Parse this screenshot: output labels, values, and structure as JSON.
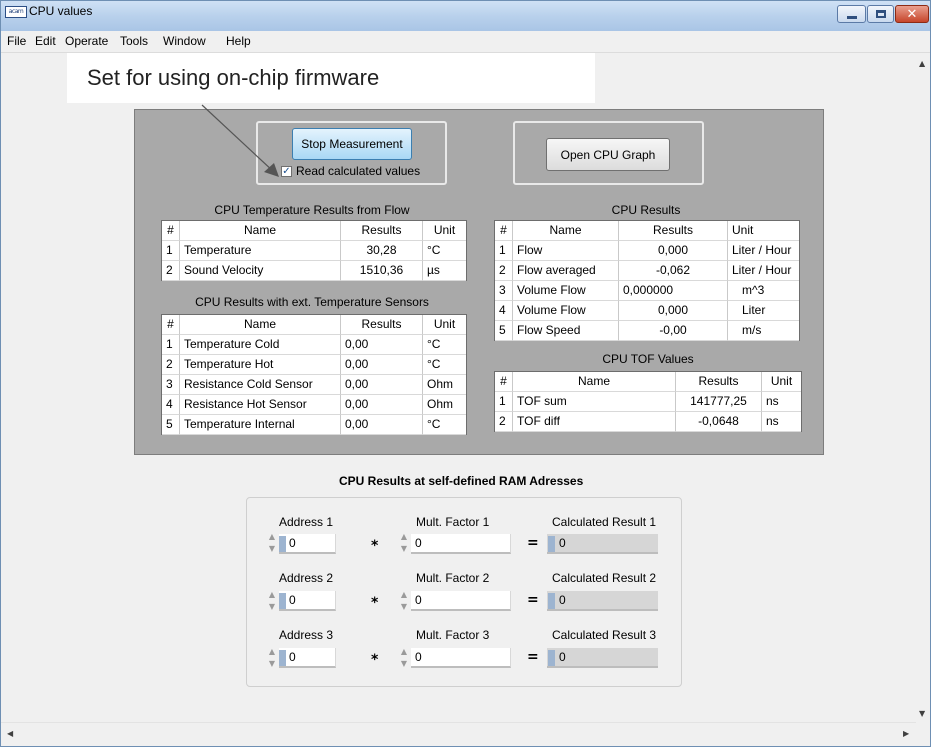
{
  "window": {
    "title": "CPU values",
    "app_icon_text": "acam"
  },
  "menu": [
    "File",
    "Edit",
    "Operate",
    "Tools",
    "Window",
    "Help"
  ],
  "callout": "Set for using on-chip firmware",
  "controls": {
    "stop_button": "Stop Measurement",
    "read_calculated_label": "Read calculated values",
    "read_calculated_checked": true,
    "open_graph_button": "Open CPU Graph"
  },
  "temperature_flow": {
    "title": "CPU Temperature Results from Flow",
    "headers": [
      "#",
      "Name",
      "Results",
      "Unit"
    ],
    "rows": [
      [
        "1",
        "Temperature",
        "30,28",
        "°C"
      ],
      [
        "2",
        "Sound Velocity",
        "1510,36",
        "µs"
      ]
    ]
  },
  "ext_sensors": {
    "title": "CPU Results with ext. Temperature Sensors",
    "headers": [
      "#",
      "Name",
      "Results",
      "Unit"
    ],
    "rows": [
      [
        "1",
        "Temperature Cold",
        "0,00",
        "°C"
      ],
      [
        "2",
        "Temperature Hot",
        "0,00",
        "°C"
      ],
      [
        "3",
        "Resistance Cold Sensor",
        "0,00",
        "Ohm"
      ],
      [
        "4",
        "Resistance Hot Sensor",
        "0,00",
        "Ohm"
      ],
      [
        "5",
        "Temperature Internal",
        "0,00",
        "°C"
      ]
    ]
  },
  "cpu_results": {
    "title": "CPU Results",
    "headers": [
      "#",
      "Name",
      "Results",
      "Unit"
    ],
    "rows": [
      [
        "1",
        "Flow",
        "0,000",
        "Liter / Hour"
      ],
      [
        "2",
        "Flow averaged",
        "-0,062",
        "Liter / Hour"
      ],
      [
        "3",
        "Volume Flow",
        "0,000000",
        "m^3"
      ],
      [
        "4",
        "Volume Flow",
        "0,000",
        "Liter"
      ],
      [
        "5",
        "Flow Speed",
        "-0,00",
        "m/s"
      ]
    ]
  },
  "tof_values": {
    "title": "CPU TOF Values",
    "headers": [
      "#",
      "Name",
      "Results",
      "Unit"
    ],
    "rows": [
      [
        "1",
        "TOF sum",
        "141777,25",
        "ns"
      ],
      [
        "2",
        "TOF diff",
        "-0,0648",
        "ns"
      ]
    ]
  },
  "ram": {
    "title": "CPU Results at self-defined RAM Adresses",
    "rows": [
      {
        "address_label": "Address 1",
        "address_value": "0",
        "factor_label": "Mult. Factor 1",
        "factor_value": "0",
        "result_label": "Calculated Result 1",
        "result_value": "0"
      },
      {
        "address_label": "Address 2",
        "address_value": "0",
        "factor_label": "Mult. Factor 2",
        "factor_value": "0",
        "result_label": "Calculated Result 2",
        "result_value": "0"
      },
      {
        "address_label": "Address 3",
        "address_value": "0",
        "factor_label": "Mult. Factor 3",
        "factor_value": "0",
        "result_label": "Calculated Result 3",
        "result_value": "0"
      }
    ],
    "multiply_symbol": "*",
    "equals_symbol": "="
  },
  "icons": {
    "minimize": "minimize-icon",
    "maximize": "maximize-icon",
    "close": "close-icon",
    "checkmark": "check-icon",
    "spin": "spin-arrows-icon"
  },
  "colors": {
    "panel_background": "#a9a9a9",
    "stop_button": "#a9d8f5",
    "close_button": "#c6452a",
    "window_background": "#f0f0f0"
  }
}
